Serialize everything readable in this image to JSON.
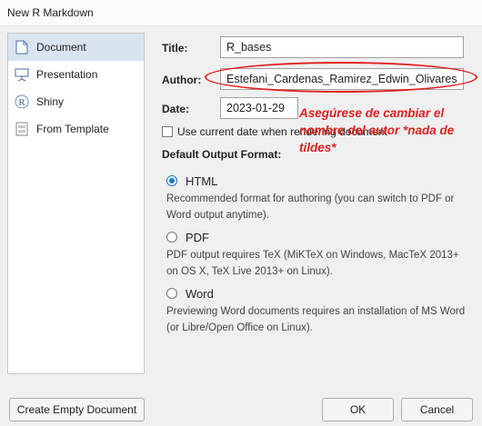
{
  "window": {
    "title": "New R Markdown"
  },
  "sidebar": {
    "items": [
      {
        "label": "Document",
        "icon": "document-icon",
        "selected": true
      },
      {
        "label": "Presentation",
        "icon": "presentation-icon",
        "selected": false
      },
      {
        "label": "Shiny",
        "icon": "shiny-icon",
        "selected": false
      },
      {
        "label": "From Template",
        "icon": "template-icon",
        "selected": false
      }
    ]
  },
  "form": {
    "title_label": "Title:",
    "title_value": "R_bases",
    "author_label": "Author:",
    "author_value": "Estefani_Cardenas_Ramirez_Edwin_Olivares",
    "date_label": "Date:",
    "date_value": "2023-01-29",
    "use_current_date_label": "Use current date when rendering document",
    "use_current_date_checked": false
  },
  "output_format": {
    "section_label": "Default Output Format:",
    "options": [
      {
        "label": "HTML",
        "checked": true,
        "description": "Recommended format for authoring (you can switch to PDF or Word output anytime)."
      },
      {
        "label": "PDF",
        "checked": false,
        "description": "PDF output requires TeX (MiKTeX on Windows, MacTeX 2013+ on OS X, TeX Live 2013+ on Linux)."
      },
      {
        "label": "Word",
        "checked": false,
        "description": "Previewing Word documents requires an installation of MS Word (or Libre/Open Office on Linux)."
      }
    ]
  },
  "annotation": {
    "text": "Asegúrese de cambiar el nombre del autor *nada de tildes*",
    "color": "#e02020"
  },
  "buttons": {
    "create_empty": "Create Empty Document",
    "ok": "OK",
    "cancel": "Cancel"
  },
  "colors": {
    "selection": "#d8e4f0",
    "radio_accent": "#1a73c8"
  }
}
